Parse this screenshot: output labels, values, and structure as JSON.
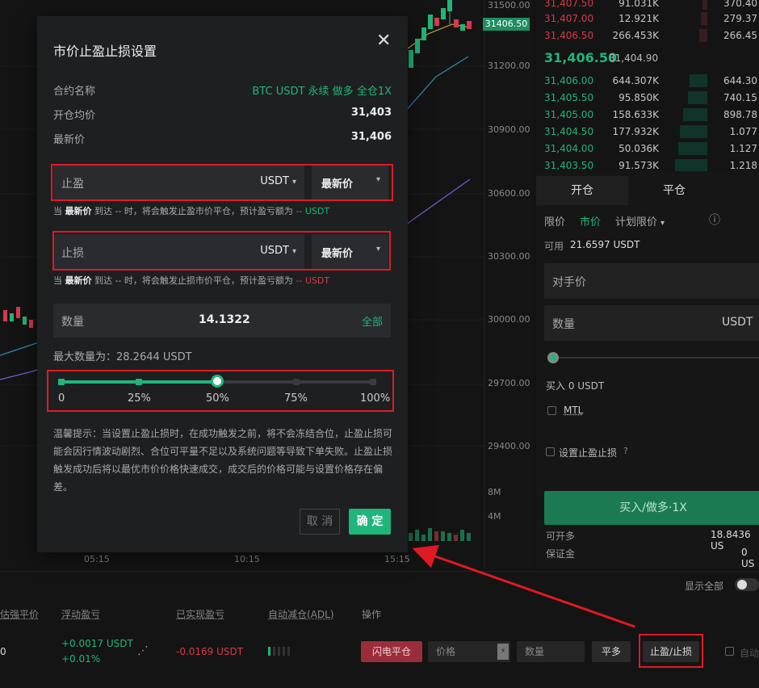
{
  "chart": {
    "price_ticks": [
      "31500.00",
      "31200.00",
      "30900.00",
      "30600.00",
      "30300.00",
      "30000.00",
      "29700.00",
      "29400.00"
    ],
    "volume_ticks": [
      "8M",
      "4M"
    ],
    "time_ticks": [
      "05:15",
      "10:15",
      "15:15"
    ],
    "current_price_tag": "31406.50"
  },
  "orderbook": {
    "asks": [
      {
        "price": "31,407.50",
        "qty": "91.031K",
        "total": "370.40"
      },
      {
        "price": "31,407.00",
        "qty": "12.921K",
        "total": "279.37"
      },
      {
        "price": "31,406.50",
        "qty": "266.453K",
        "total": "266.45"
      }
    ],
    "last_price": "31,406.50",
    "mark_price": "31,404.90",
    "bids": [
      {
        "price": "31,406.00",
        "qty": "644.307K",
        "total": "644.30"
      },
      {
        "price": "31,405.50",
        "qty": "95.850K",
        "total": "740.15"
      },
      {
        "price": "31,405.00",
        "qty": "158.633K",
        "total": "898.78"
      },
      {
        "price": "31,404.50",
        "qty": "177.932K",
        "total": "1.077"
      },
      {
        "price": "31,404.00",
        "qty": "50.036K",
        "total": "1.127"
      },
      {
        "price": "31,403.50",
        "qty": "91.573K",
        "total": "1.218"
      }
    ]
  },
  "trade": {
    "tab_open": "开仓",
    "tab_close": "平仓",
    "order_types": [
      "限价",
      "市价",
      "计划限价"
    ],
    "info_icon": "ⓘ",
    "available_label": "可用",
    "available_value": "21.6597 USDT",
    "counterparty_label": "对手价",
    "qty_label": "数量",
    "qty_unit": "USDT",
    "buy_amount": "买入 0 USDT",
    "mtl_label": "MTL",
    "tpsl_label": "设置止盈止损",
    "buy_button": "买入/做多·1X",
    "can_open_label": "可开多",
    "can_open_value": "18.8436 US",
    "margin_label": "保证金",
    "margin_value": "0 US"
  },
  "positions": {
    "show_all_label": "显示全部",
    "headers": [
      "估强平价",
      "浮动盈亏",
      "已实现盈亏",
      "自动减仓(ADL)",
      "操作"
    ],
    "liq_price": "0",
    "pnl_value": "+0.0017 USDT",
    "pnl_pct": "+0.01%",
    "realized_pnl": "-0.0169 USDT",
    "flash_close_button": "闪电平仓",
    "price_placeholder": "价格",
    "qty_placeholder": "数量",
    "close_long_button": "平多",
    "tpsl_button": "止盈/止损",
    "auto_label": "自动"
  },
  "modal": {
    "title": "市价止盈止损设置",
    "close_icon": "✕",
    "contract_label": "合约名称",
    "contract_value": "BTC USDT 永续 做多 全仓1X",
    "entry_label": "开仓均价",
    "entry_value": "31,403",
    "latest_label": "最新价",
    "latest_value": "31,406",
    "tp_label": "止盈",
    "tp_unit": "USDT",
    "tp_trigger": "最新价",
    "tp_hint_prefix": "当",
    "tp_hint_bold": "最新价",
    "tp_hint_mid": "到达 -- 时，将会触发止盈市价平仓，预计盈亏额为",
    "tp_hint_value": "-- USDT",
    "sl_label": "止损",
    "sl_unit": "USDT",
    "sl_trigger": "最新价",
    "sl_hint_prefix": "当",
    "sl_hint_bold": "最新价",
    "sl_hint_mid": "到达 -- 时，将会触发止损市价平仓，预计盈亏额为",
    "sl_hint_value": "-- USDT",
    "qty_label": "数量",
    "qty_value": "14.1322",
    "qty_all": "全部",
    "max_qty_label": "最大数量为：28.2644 USDT",
    "slider_percent": 0.5,
    "slider_labels": [
      "0",
      "25%",
      "50%",
      "75%",
      "100%"
    ],
    "tips": "温馨提示：当设置止盈止损时，在成功触发之前，将不会冻结合位，止盈止损可能会因行情波动剧烈、合位可平量不足以及系统问题等导致下单失败。止盈止损触发成功后将以最优市价价格快速成交，成交后的价格可能与设置价格存在偏差。",
    "cancel_button": "取 消",
    "confirm_button": "确 定"
  },
  "colors": {
    "up": "#22b57a",
    "down": "#d6394a",
    "annotation": "#e01a22"
  }
}
